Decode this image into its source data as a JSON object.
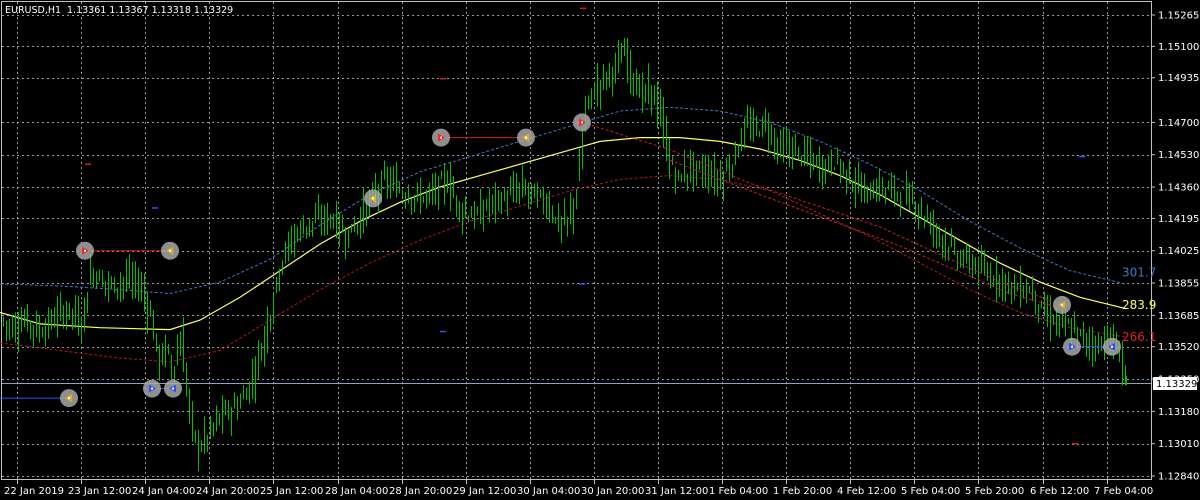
{
  "symbol_header": {
    "symbol": "EURUSD,H1",
    "ohlc": "1.13361 1.13367 1.13318 1.13329"
  },
  "colors": {
    "background": "#000000",
    "grid": "#c0c0c0",
    "candles": "#00c000",
    "yellow_ma": "#ffff66",
    "blue_band": "#3a78c8",
    "red_band": "#b01818",
    "price_line": "#8fa3bf",
    "marker_circle": "#a8a8a8"
  },
  "chart_data": {
    "type": "candlestick",
    "y_ticks": [
      "1.15265",
      "1.15100",
      "1.14935",
      "1.14700",
      "1.14530",
      "1.14360",
      "1.14195",
      "1.14025",
      "1.13855",
      "1.13685",
      "1.13520",
      "1.13350",
      "1.13180",
      "1.13010",
      "1.12840"
    ],
    "y_values": [
      1.15265,
      1.151,
      1.14935,
      1.147,
      1.1453,
      1.1436,
      1.14195,
      1.14025,
      1.13855,
      1.13685,
      1.1352,
      1.1335,
      1.1318,
      1.1301,
      1.1284
    ],
    "x_ticks": [
      "22 Jan 2019",
      "23 Jan 12:00",
      "24 Jan 04:00",
      "24 Jan 20:00",
      "25 Jan 12:00",
      "28 Jan 04:00",
      "28 Jan 20:00",
      "29 Jan 12:00",
      "30 Jan 04:00",
      "30 Jan 20:00",
      "31 Jan 12:00",
      "1 Feb 04:00",
      "1 Feb 20:00",
      "4 Feb 12:00",
      "5 Feb 04:00",
      "5 Feb 20:00",
      "6 Feb 12:00",
      "7 Feb 04:00"
    ],
    "current_price": "1.13329",
    "right_labels": [
      {
        "text": "301.7",
        "color": "#3a78c8",
        "y": 1.1391
      },
      {
        "text": "283.9",
        "color": "#ffff66",
        "y": 1.1374
      },
      {
        "text": "266.1",
        "color": "#e02020",
        "y": 1.1357
      }
    ],
    "price_path": [
      [
        0,
        1.1366
      ],
      [
        12,
        1.1362
      ],
      [
        25,
        1.1366
      ],
      [
        40,
        1.136
      ],
      [
        55,
        1.1368
      ],
      [
        70,
        1.1372
      ],
      [
        80,
        1.1362
      ],
      [
        90,
        1.1392
      ],
      [
        100,
        1.1388
      ],
      [
        112,
        1.1384
      ],
      [
        125,
        1.1388
      ],
      [
        140,
        1.1384
      ],
      [
        150,
        1.1368
      ],
      [
        158,
        1.1343
      ],
      [
        165,
        1.1352
      ],
      [
        172,
        1.1338
      ],
      [
        180,
        1.1357
      ],
      [
        188,
        1.1318
      ],
      [
        196,
        1.1298
      ],
      [
        206,
        1.1305
      ],
      [
        220,
        1.1316
      ],
      [
        235,
        1.132
      ],
      [
        248,
        1.133
      ],
      [
        260,
        1.135
      ],
      [
        270,
        1.1372
      ],
      [
        280,
        1.1398
      ],
      [
        295,
        1.1412
      ],
      [
        310,
        1.1418
      ],
      [
        330,
        1.142
      ],
      [
        345,
        1.141
      ],
      [
        360,
        1.142
      ],
      [
        372,
        1.1432
      ],
      [
        385,
        1.144
      ],
      [
        400,
        1.1434
      ],
      [
        415,
        1.143
      ],
      [
        430,
        1.1432
      ],
      [
        445,
        1.144
      ],
      [
        460,
        1.1424
      ],
      [
        475,
        1.142
      ],
      [
        490,
        1.1428
      ],
      [
        505,
        1.143
      ],
      [
        520,
        1.1436
      ],
      [
        535,
        1.1432
      ],
      [
        548,
        1.1426
      ],
      [
        558,
        1.1416
      ],
      [
        568,
        1.1418
      ],
      [
        578,
        1.144
      ],
      [
        584,
        1.1478
      ],
      [
        590,
        1.1484
      ],
      [
        600,
        1.1492
      ],
      [
        612,
        1.1498
      ],
      [
        624,
        1.1506
      ],
      [
        632,
        1.1494
      ],
      [
        640,
        1.1484
      ],
      [
        650,
        1.1488
      ],
      [
        660,
        1.1472
      ],
      [
        668,
        1.145
      ],
      [
        676,
        1.144
      ],
      [
        690,
        1.1446
      ],
      [
        705,
        1.1444
      ],
      [
        718,
        1.144
      ],
      [
        728,
        1.1446
      ],
      [
        736,
        1.1456
      ],
      [
        745,
        1.1468
      ],
      [
        755,
        1.1466
      ],
      [
        765,
        1.147
      ],
      [
        775,
        1.1458
      ],
      [
        790,
        1.1456
      ],
      [
        805,
        1.1452
      ],
      [
        820,
        1.1446
      ],
      [
        835,
        1.145
      ],
      [
        850,
        1.144
      ],
      [
        865,
        1.1432
      ],
      [
        880,
        1.1436
      ],
      [
        895,
        1.1434
      ],
      [
        910,
        1.143
      ],
      [
        925,
        1.142
      ],
      [
        940,
        1.141
      ],
      [
        955,
        1.14
      ],
      [
        970,
        1.1396
      ],
      [
        985,
        1.139
      ],
      [
        1000,
        1.1388
      ],
      [
        1015,
        1.1382
      ],
      [
        1030,
        1.1382
      ],
      [
        1045,
        1.1368
      ],
      [
        1060,
        1.1364
      ],
      [
        1072,
        1.136
      ],
      [
        1085,
        1.1356
      ],
      [
        1097,
        1.1352
      ],
      [
        1105,
        1.1358
      ],
      [
        1112,
        1.1352
      ],
      [
        1118,
        1.135
      ],
      [
        1126,
        1.1333
      ]
    ],
    "yellow_ma": [
      [
        0,
        1.137
      ],
      [
        40,
        1.1364
      ],
      [
        100,
        1.1362
      ],
      [
        170,
        1.1361
      ],
      [
        200,
        1.1366
      ],
      [
        240,
        1.1378
      ],
      [
        280,
        1.1392
      ],
      [
        320,
        1.1406
      ],
      [
        360,
        1.1418
      ],
      [
        400,
        1.1428
      ],
      [
        440,
        1.1436
      ],
      [
        480,
        1.1442
      ],
      [
        520,
        1.1448
      ],
      [
        560,
        1.1454
      ],
      [
        600,
        1.146
      ],
      [
        640,
        1.1462
      ],
      [
        680,
        1.1462
      ],
      [
        720,
        1.146
      ],
      [
        760,
        1.1456
      ],
      [
        800,
        1.145
      ],
      [
        840,
        1.1442
      ],
      [
        880,
        1.1432
      ],
      [
        920,
        1.142
      ],
      [
        960,
        1.1408
      ],
      [
        1000,
        1.1396
      ],
      [
        1040,
        1.1386
      ],
      [
        1080,
        1.1378
      ],
      [
        1126,
        1.1372
      ]
    ],
    "blue_upper": [
      [
        0,
        1.1385
      ],
      [
        60,
        1.1384
      ],
      [
        120,
        1.1382
      ],
      [
        170,
        1.138
      ],
      [
        220,
        1.1386
      ],
      [
        270,
        1.1398
      ],
      [
        320,
        1.1416
      ],
      [
        370,
        1.1432
      ],
      [
        420,
        1.1444
      ],
      [
        470,
        1.1452
      ],
      [
        520,
        1.146
      ],
      [
        570,
        1.1468
      ],
      [
        620,
        1.1476
      ],
      [
        670,
        1.1478
      ],
      [
        720,
        1.1476
      ],
      [
        770,
        1.147
      ],
      [
        820,
        1.146
      ],
      [
        870,
        1.1448
      ],
      [
        920,
        1.1434
      ],
      [
        970,
        1.1418
      ],
      [
        1020,
        1.1404
      ],
      [
        1070,
        1.1392
      ],
      [
        1126,
        1.1385
      ]
    ],
    "red_lower": [
      [
        0,
        1.1354
      ],
      [
        60,
        1.135
      ],
      [
        120,
        1.1346
      ],
      [
        170,
        1.1344
      ],
      [
        220,
        1.135
      ],
      [
        270,
        1.1366
      ],
      [
        320,
        1.1382
      ],
      [
        370,
        1.1396
      ],
      [
        420,
        1.1408
      ],
      [
        470,
        1.1418
      ],
      [
        520,
        1.1426
      ],
      [
        570,
        1.1434
      ],
      [
        620,
        1.144
      ],
      [
        670,
        1.1442
      ],
      [
        720,
        1.144
      ],
      [
        770,
        1.1434
      ],
      [
        820,
        1.1422
      ],
      [
        870,
        1.141
      ],
      [
        920,
        1.1396
      ],
      [
        970,
        1.1382
      ],
      [
        1020,
        1.137
      ],
      [
        1070,
        1.1362
      ],
      [
        1126,
        1.1357
      ]
    ],
    "segments": [
      {
        "color": "#cc2020",
        "pts": [
          [
            85,
            1.14025
          ],
          [
            170,
            1.14025
          ]
        ]
      },
      {
        "color": "#cc2020",
        "pts": [
          [
            441,
            1.1462
          ],
          [
            526,
            1.1462
          ]
        ]
      },
      {
        "color": "#cc2020",
        "dash": "3,2",
        "pts": [
          [
            582,
            1.147
          ],
          [
            668,
            1.1456
          ],
          [
            750,
            1.1438
          ],
          [
            880,
            1.1415
          ],
          [
            1000,
            1.1386
          ],
          [
            1062,
            1.1374
          ]
        ]
      },
      {
        "color": "#cc2020",
        "dash": "3,2",
        "pts": [
          [
            670,
            1.145
          ],
          [
            760,
            1.1432
          ],
          [
            900,
            1.1405
          ],
          [
            1010,
            1.138
          ],
          [
            1062,
            1.1372
          ]
        ]
      },
      {
        "color": "#3050ff",
        "pts": [
          [
            0,
            1.1325
          ],
          [
            69,
            1.1325
          ]
        ]
      },
      {
        "color": "#3050ff",
        "pts": [
          [
            152,
            1.133
          ],
          [
            173,
            1.133
          ]
        ]
      },
      {
        "color": "#3050ff",
        "pts": [
          [
            1072,
            1.1352
          ],
          [
            1112,
            1.1352
          ]
        ]
      }
    ],
    "markers": [
      {
        "x": 69,
        "y": 1.1325,
        "kind": "tri-left",
        "color": "#e0b020"
      },
      {
        "x": 85,
        "y": 1.14025,
        "kind": "tri-right",
        "color": "#ff2020"
      },
      {
        "x": 170,
        "y": 1.14025,
        "kind": "tri-left",
        "color": "#e0b020"
      },
      {
        "x": 152,
        "y": 1.133,
        "kind": "tri-right",
        "color": "#3050ff"
      },
      {
        "x": 173,
        "y": 1.133,
        "kind": "tri-left",
        "color": "#3050ff"
      },
      {
        "x": 373,
        "y": 1.143,
        "kind": "tri-left",
        "color": "#e0b020"
      },
      {
        "x": 441,
        "y": 1.1462,
        "kind": "tri-right",
        "color": "#ff2020"
      },
      {
        "x": 526,
        "y": 1.1462,
        "kind": "tri-left",
        "color": "#e0b020"
      },
      {
        "x": 582,
        "y": 1.147,
        "kind": "tri-right",
        "color": "#ff2020"
      },
      {
        "x": 1062,
        "y": 1.1374,
        "kind": "tri-left",
        "color": "#e0b020"
      },
      {
        "x": 1072,
        "y": 1.1352,
        "kind": "tri-right",
        "color": "#3050ff"
      },
      {
        "x": 1112,
        "y": 1.1352,
        "kind": "tri-left",
        "color": "#3050ff"
      }
    ],
    "dashes": [
      {
        "x": 583,
        "y": 1.153,
        "color": "#cc2020"
      },
      {
        "x": 443,
        "y": 1.1493,
        "color": "#cc2020"
      },
      {
        "x": 88,
        "y": 1.1448,
        "color": "#cc2020"
      },
      {
        "x": 155,
        "y": 1.1425,
        "color": "#3050ff"
      },
      {
        "x": 582,
        "y": 1.1385,
        "color": "#3050ff"
      },
      {
        "x": 443,
        "y": 1.136,
        "color": "#3050ff"
      },
      {
        "x": 1082,
        "y": 1.1452,
        "color": "#3050ff"
      },
      {
        "x": 1075,
        "y": 1.1301,
        "color": "#cc2020"
      }
    ]
  }
}
